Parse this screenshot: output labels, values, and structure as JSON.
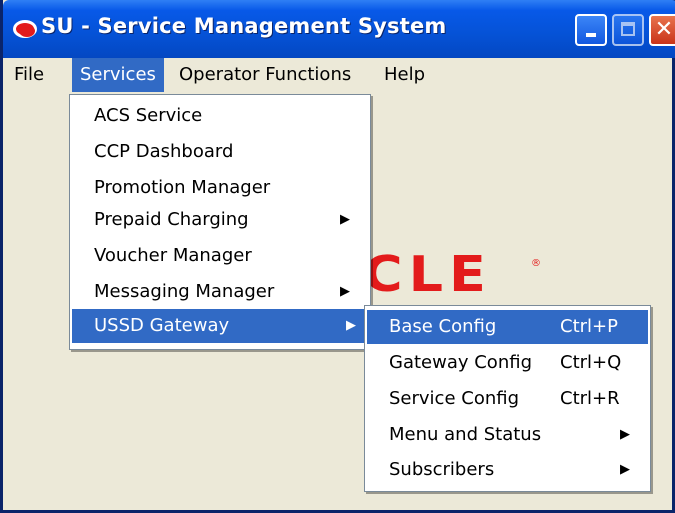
{
  "window": {
    "title": "SU - Service Management System"
  },
  "menubar": {
    "items": [
      {
        "label": "File"
      },
      {
        "label": "Services"
      },
      {
        "label": "Operator Functions"
      },
      {
        "label": "Help"
      }
    ]
  },
  "services_menu": {
    "items": [
      {
        "label": "ACS Service"
      },
      {
        "label": "CCP Dashboard"
      },
      {
        "label": "Promotion Manager"
      },
      {
        "label": "Prepaid Charging",
        "arrow": "▶"
      },
      {
        "label": "Voucher Manager"
      },
      {
        "label": "Messaging Manager",
        "arrow": "▶"
      },
      {
        "label": "USSD Gateway",
        "arrow": "▶"
      }
    ]
  },
  "ussd_submenu": {
    "items": [
      {
        "label": "Base Config",
        "shortcut": "Ctrl+P"
      },
      {
        "label": "Gateway Config",
        "shortcut": "Ctrl+Q"
      },
      {
        "label": "Service Config",
        "shortcut": "Ctrl+R"
      },
      {
        "label": "Menu and Status",
        "arrow": "▶"
      },
      {
        "label": "Subscribers",
        "arrow": "▶"
      }
    ]
  },
  "background_logo": {
    "text": "CLE",
    "reg": "®"
  },
  "colors": {
    "titlebar": "#0552d6",
    "highlight": "#316ac5",
    "logo": "#e31b1b",
    "face": "#ece9d8"
  }
}
